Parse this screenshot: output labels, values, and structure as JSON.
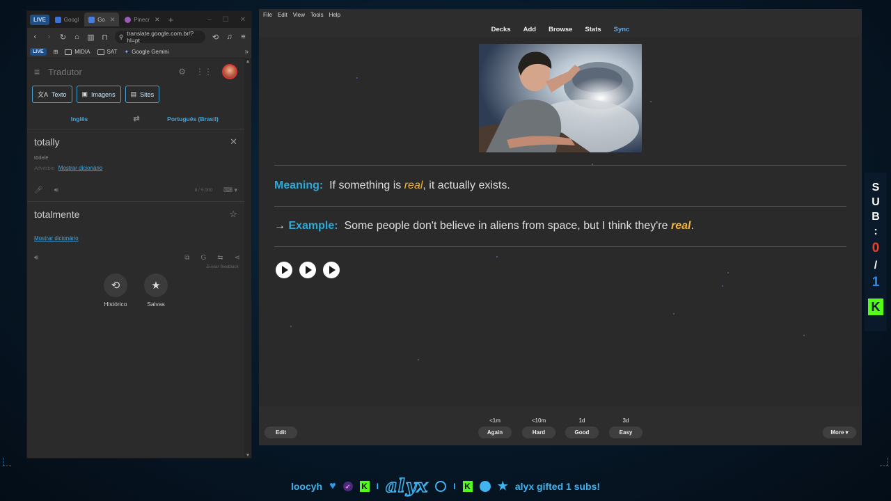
{
  "browser": {
    "tab_live": "LIVE",
    "tabs": [
      {
        "label": "Googl",
        "active": false
      },
      {
        "label": "Go",
        "active": true
      },
      {
        "label": "Pinecr",
        "active": false
      }
    ],
    "url": "translate.google.com.br/?hl=pt",
    "bookmarks": {
      "live": "LIVE",
      "items": [
        "MIDIA",
        "SAT",
        "Google Gemini"
      ],
      "more": "»"
    }
  },
  "translator": {
    "title": "Tradutor",
    "modes": [
      "Texto",
      "Imagens",
      "Sites"
    ],
    "source_lang": "Inglês",
    "swap_icon": "⇄",
    "target_lang": "Português (Brasil)",
    "source_text": "totally",
    "transliteration": "tōdelē",
    "pos": "Advérbio",
    "show_dictionary": "Mostrar dicionário",
    "char_count": "8 / 5.000",
    "target_text": "totalmente",
    "target_show_dictionary": "Mostrar dicionário",
    "feedback": "Enviar feedback",
    "history_label": "Histórico",
    "saved_label": "Salvas"
  },
  "anki": {
    "menu": [
      "File",
      "Edit",
      "View",
      "Tools",
      "Help"
    ],
    "toolbar": [
      "Decks",
      "Add",
      "Browse",
      "Stats"
    ],
    "sync": "Sync",
    "meaning_label": "Meaning:",
    "meaning_pre": "If something is ",
    "meaning_word": "real",
    "meaning_post": ", it actually exists.",
    "example_arrow": "→",
    "example_label": "Example:",
    "example_pre": "Some people don't believe in aliens from space, but I think they're ",
    "example_word": "real",
    "example_post": ".",
    "edit": "Edit",
    "more": "More ▾",
    "answers": [
      {
        "interval": "<1m",
        "label": "Again"
      },
      {
        "interval": "<10m",
        "label": "Hard"
      },
      {
        "interval": "1d",
        "label": "Good"
      },
      {
        "interval": "3d",
        "label": "Easy"
      }
    ]
  },
  "sub_goal": {
    "letters": [
      "S",
      "U",
      "B",
      ":"
    ],
    "current": "0",
    "slash": "/",
    "goal": "1",
    "badge": "K"
  },
  "ticker": {
    "user": "loocyh",
    "logo": "alyx",
    "gift_msg": "alyx gifted 1 subs!",
    "separator": "I",
    "kick": "K"
  },
  "colors": {
    "accent_blue": "#2fa8d6",
    "highlight": "#f0b43c",
    "kick_green": "#53fc18",
    "sub_current": "#e8412c"
  }
}
